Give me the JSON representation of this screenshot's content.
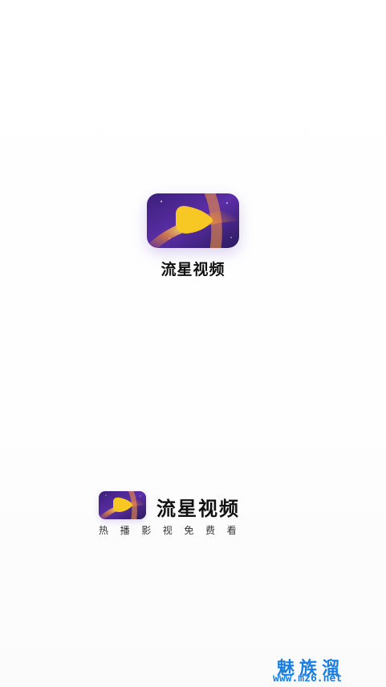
{
  "app": {
    "name": "流星视频",
    "slogan": "热播影视免费看"
  },
  "center": {
    "logo_icon": "meteor-play-icon",
    "title": "流星视频"
  },
  "footer": {
    "logo_icon": "meteor-play-icon",
    "brand_name": "流星视频",
    "slogan": "热播影视免费看"
  },
  "watermark": {
    "text": "魅族溜",
    "url": "www.mz6.net",
    "color": "#1a7fe0"
  },
  "colors": {
    "logo_bg_dark": "#2a1a5e",
    "logo_bg_purple": "#5b2ea6",
    "logo_meteor_yellow": "#f7c824",
    "logo_glow_orange": "#f08a2c"
  }
}
